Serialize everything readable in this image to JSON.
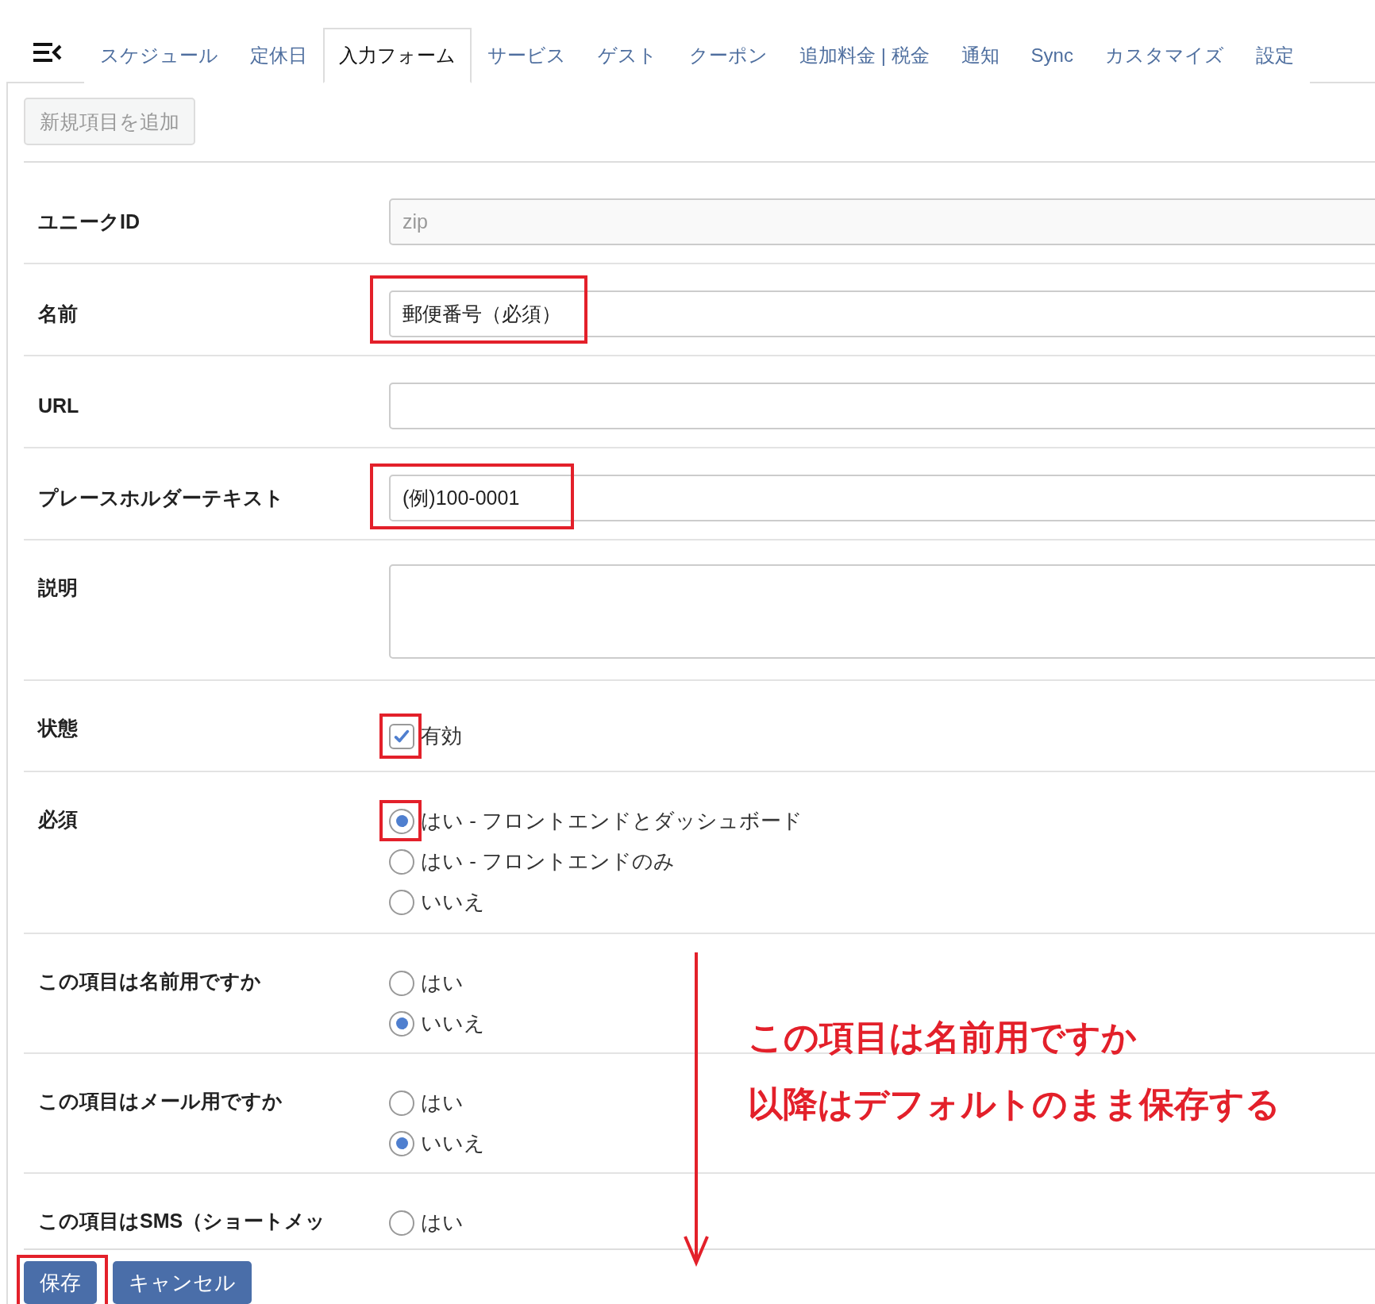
{
  "tabs": [
    {
      "label": "スケジュール",
      "selected": false
    },
    {
      "label": "定休日",
      "selected": false
    },
    {
      "label": "入力フォーム",
      "selected": true
    },
    {
      "label": "サービス",
      "selected": false
    },
    {
      "label": "ゲスト",
      "selected": false
    },
    {
      "label": "クーポン",
      "selected": false
    },
    {
      "label": "追加料金 | 税金",
      "selected": false
    },
    {
      "label": "通知",
      "selected": false
    },
    {
      "label": "Sync",
      "selected": false
    },
    {
      "label": "カスタマイズ",
      "selected": false
    },
    {
      "label": "設定",
      "selected": false
    }
  ],
  "add_button": {
    "label": "新規項目を追加",
    "disabled": true
  },
  "form_rows": [
    {
      "kind": "text",
      "label": "ユニークID",
      "value": "zip",
      "disabled": true,
      "highlighted": false
    },
    {
      "kind": "text",
      "label": "名前",
      "value": "郵便番号（必須）",
      "disabled": false,
      "highlighted": true
    },
    {
      "kind": "text",
      "label": "URL",
      "highlighted": false
    },
    {
      "kind": "text",
      "label": "プレースホルダーテキスト",
      "value": "(例)100-0001",
      "disabled": false,
      "highlighted": true
    },
    {
      "kind": "textarea",
      "label": "説明"
    },
    {
      "kind": "checkbox",
      "label": "状態",
      "option": "有効",
      "checked": true,
      "highlighted": true
    },
    {
      "kind": "radio",
      "label": "必須",
      "options": [
        {
          "label": "はい - フロントエンドとダッシュボード",
          "selected": true,
          "highlighted": true
        },
        {
          "label": "はい - フロントエンドのみ",
          "selected": false,
          "highlighted": false
        },
        {
          "label": "いいえ",
          "selected": false,
          "highlighted": false
        }
      ]
    },
    {
      "kind": "radio",
      "label": "この項目は名前用ですか",
      "options": [
        {
          "label": "はい",
          "selected": false,
          "highlighted": false
        },
        {
          "label": "いいえ",
          "selected": true,
          "highlighted": false
        }
      ]
    },
    {
      "kind": "radio",
      "label": "この項目はメール用ですか",
      "options": [
        {
          "label": "はい",
          "selected": false,
          "highlighted": false
        },
        {
          "label": "いいえ",
          "selected": true,
          "highlighted": false
        }
      ]
    },
    {
      "kind": "radio",
      "label": "この項目はSMS（ショートメッ",
      "options": [
        {
          "label": "はい",
          "selected": false,
          "highlighted": false
        }
      ]
    }
  ],
  "footer_buttons": [
    {
      "label": "保存",
      "highlighted": true
    },
    {
      "label": "キャンセル",
      "highlighted": false
    }
  ],
  "annotation": {
    "lines": [
      "この項目は名前用ですか",
      "以降はデフォルトのまま保存する"
    ]
  }
}
